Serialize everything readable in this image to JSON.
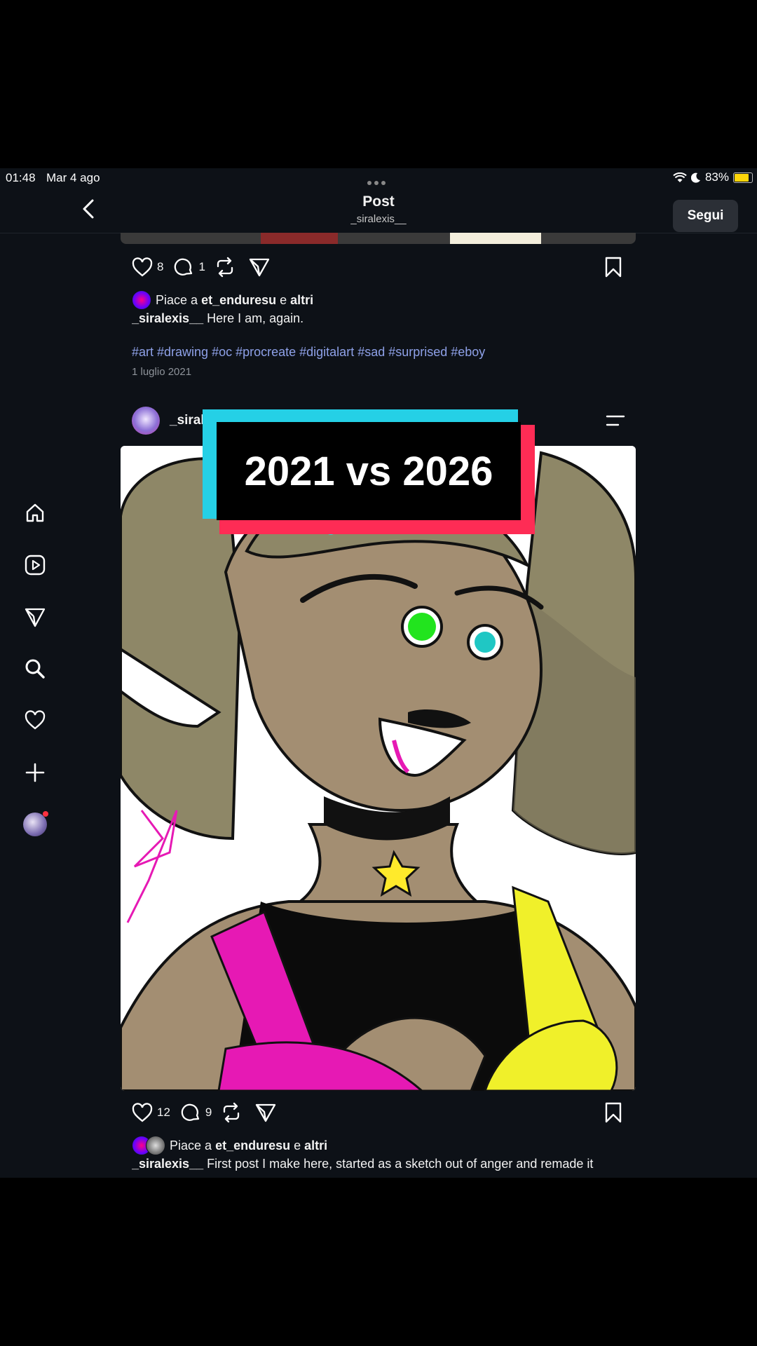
{
  "status_bar": {
    "time": "01:48",
    "date": "Mar 4 ago",
    "battery": "83%"
  },
  "header": {
    "title": "Post",
    "subtitle": "_siralexis__",
    "follow_label": "Segui"
  },
  "sidebar": {
    "items": [
      "home-icon",
      "reels-icon",
      "messages-icon",
      "search-icon",
      "heart-icon",
      "create-icon",
      "profile-avatar"
    ]
  },
  "posts": [
    {
      "likes_count": "8",
      "comments_count": "1",
      "liked_by_prefix": "Piace a",
      "liked_by_user": "et_enduresu",
      "liked_by_joiner": "e",
      "liked_by_others": "altri",
      "caption_user": "_siralexis__",
      "caption_text": "Here I am, again.",
      "hashtags": "#art #drawing #oc #procreate #digitalart #sad #surprised #eboy",
      "date": "1 luglio 2021"
    },
    {
      "username": "_siral",
      "overlay_text": "2021 vs 2026",
      "likes_count": "12",
      "comments_count": "9",
      "liked_by_prefix": "Piace a",
      "liked_by_user": "et_enduresu",
      "liked_by_joiner": "e",
      "liked_by_others": "altri",
      "caption_user": "_siralexis__",
      "caption_text": "First post I make here, started as a sketch out of anger and remade it"
    }
  ],
  "colors": {
    "background": "#0d1117",
    "hashtag": "#8ea1e8",
    "overlay_cyan": "#25d0e6",
    "overlay_red": "#fe2c55",
    "follow_button": "#2b2f36"
  }
}
